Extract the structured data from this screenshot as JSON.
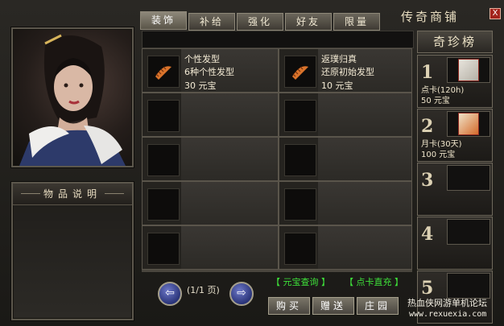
{
  "window": {
    "title": "传奇商铺",
    "close": "X"
  },
  "tabs": [
    "装饰",
    "补给",
    "强化",
    "好友",
    "限量"
  ],
  "description": {
    "title": "物品说明"
  },
  "items": [
    {
      "name": "个性发型",
      "desc": "6种个性发型",
      "price": "30 元宝",
      "icon": "comb-icon"
    },
    {
      "name": "返璞归真",
      "desc": "还原初始发型",
      "price": "10 元宝",
      "icon": "comb-icon"
    },
    {
      "name": "",
      "desc": "",
      "price": ""
    },
    {
      "name": "",
      "desc": "",
      "price": ""
    },
    {
      "name": "",
      "desc": "",
      "price": ""
    },
    {
      "name": "",
      "desc": "",
      "price": ""
    },
    {
      "name": "",
      "desc": "",
      "price": ""
    },
    {
      "name": "",
      "desc": "",
      "price": ""
    },
    {
      "name": "",
      "desc": "",
      "price": ""
    },
    {
      "name": "",
      "desc": "",
      "price": ""
    }
  ],
  "pager": {
    "text": "(1/1 页)"
  },
  "links": {
    "query": "【 元宝查询 】",
    "recharge": "【 点卡直充 】"
  },
  "actions": {
    "buy": "购买",
    "gift": "赠送",
    "manor": "庄园"
  },
  "rank": {
    "title": "奇珍榜",
    "entries": [
      {
        "num": "1",
        "name": "点卡(120h)",
        "price": "50 元宝"
      },
      {
        "num": "2",
        "name": "月卡(30天)",
        "price": "100 元宝"
      },
      {
        "num": "3",
        "name": "",
        "price": ""
      },
      {
        "num": "4",
        "name": "",
        "price": ""
      },
      {
        "num": "5",
        "name": "",
        "price": ""
      }
    ]
  },
  "watermark": {
    "line1": "热血侠网游单机论坛",
    "line2": "www.rexuexia.com"
  },
  "colors": {
    "green": "#3ee23a",
    "accent": "#a3241c"
  }
}
